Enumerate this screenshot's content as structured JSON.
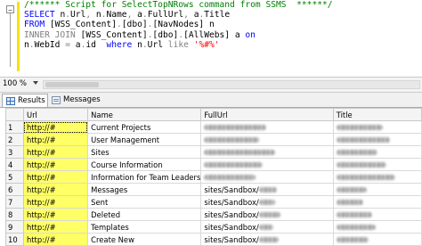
{
  "editor": {
    "fold_glyph": "−",
    "lines": [
      [
        {
          "t": "/****** Script for SelectTopNRows command from SSMS  ******/",
          "c": "cm"
        }
      ],
      [
        {
          "t": "SELECT ",
          "c": "kw"
        },
        {
          "t": "n",
          "c": "tx"
        },
        {
          "t": ".",
          "c": "gy"
        },
        {
          "t": "Url",
          "c": "tx"
        },
        {
          "t": ", ",
          "c": "gy"
        },
        {
          "t": "n",
          "c": "tx"
        },
        {
          "t": ".",
          "c": "gy"
        },
        {
          "t": "Name",
          "c": "tx"
        },
        {
          "t": ", ",
          "c": "gy"
        },
        {
          "t": "a",
          "c": "tx"
        },
        {
          "t": ".",
          "c": "gy"
        },
        {
          "t": "FullUrl",
          "c": "tx"
        },
        {
          "t": ", ",
          "c": "gy"
        },
        {
          "t": "a",
          "c": "tx"
        },
        {
          "t": ".",
          "c": "gy"
        },
        {
          "t": "Title",
          "c": "tx"
        }
      ],
      [
        {
          "t": "FROM ",
          "c": "kw"
        },
        {
          "t": "[WSS_Content]",
          "c": "tx"
        },
        {
          "t": ".",
          "c": "gy"
        },
        {
          "t": "[dbo]",
          "c": "tx"
        },
        {
          "t": ".",
          "c": "gy"
        },
        {
          "t": "[NavNodes]",
          "c": "tx"
        },
        {
          "t": " n",
          "c": "tx"
        }
      ],
      [
        {
          "t": "INNER JOIN ",
          "c": "gy"
        },
        {
          "t": "[WSS_Content]",
          "c": "tx"
        },
        {
          "t": ".",
          "c": "gy"
        },
        {
          "t": "[dbo]",
          "c": "tx"
        },
        {
          "t": ".",
          "c": "gy"
        },
        {
          "t": "[AllWebs]",
          "c": "tx"
        },
        {
          "t": " a ",
          "c": "tx"
        },
        {
          "t": "on",
          "c": "kw"
        }
      ],
      [
        {
          "t": "n",
          "c": "tx"
        },
        {
          "t": ".",
          "c": "gy"
        },
        {
          "t": "WebId ",
          "c": "tx"
        },
        {
          "t": "= ",
          "c": "gy"
        },
        {
          "t": "a",
          "c": "tx"
        },
        {
          "t": ".",
          "c": "gy"
        },
        {
          "t": "id  ",
          "c": "tx"
        },
        {
          "t": "where ",
          "c": "kw"
        },
        {
          "t": "n",
          "c": "tx"
        },
        {
          "t": ".",
          "c": "gy"
        },
        {
          "t": "Url ",
          "c": "tx"
        },
        {
          "t": "like ",
          "c": "gy"
        },
        {
          "t": "'%#%'",
          "c": "st"
        }
      ]
    ]
  },
  "zoom": {
    "value": "100 %"
  },
  "tabs": [
    {
      "label": "Results",
      "icon": "grid-icon"
    },
    {
      "label": "Messages",
      "icon": "message-icon"
    }
  ],
  "grid": {
    "columns": [
      "Url",
      "Name",
      "FullUrl",
      "Title"
    ],
    "rows": [
      {
        "num": "1",
        "url": "http://#",
        "name": "Current Projects"
      },
      {
        "num": "2",
        "url": "http://#",
        "name": "User Management"
      },
      {
        "num": "3",
        "url": "http://#",
        "name": "Sites"
      },
      {
        "num": "4",
        "url": "http://#",
        "name": "Course Information"
      },
      {
        "num": "5",
        "url": "http://#",
        "name": "Information for Team Leaders"
      },
      {
        "num": "6",
        "url": "http://#",
        "name": "Messages",
        "full_prefix": "sites/Sandbox/"
      },
      {
        "num": "7",
        "url": "http://#",
        "name": "Sent",
        "full_prefix": "sites/Sandbox/"
      },
      {
        "num": "8",
        "url": "http://#",
        "name": "Deleted",
        "full_prefix": "sites/Sandbox/"
      },
      {
        "num": "9",
        "url": "http://#",
        "name": "Templates",
        "full_prefix": "sites/Sandbox/"
      },
      {
        "num": "10",
        "url": "http://#",
        "name": "Create New",
        "full_prefix": "sites/Sandbox/"
      }
    ],
    "highlight_color": "#ffff66"
  },
  "colors": {
    "keyword": "#0000ff",
    "comment": "#008000",
    "string": "#ff0000",
    "gutter_marker": "#f7e200"
  }
}
